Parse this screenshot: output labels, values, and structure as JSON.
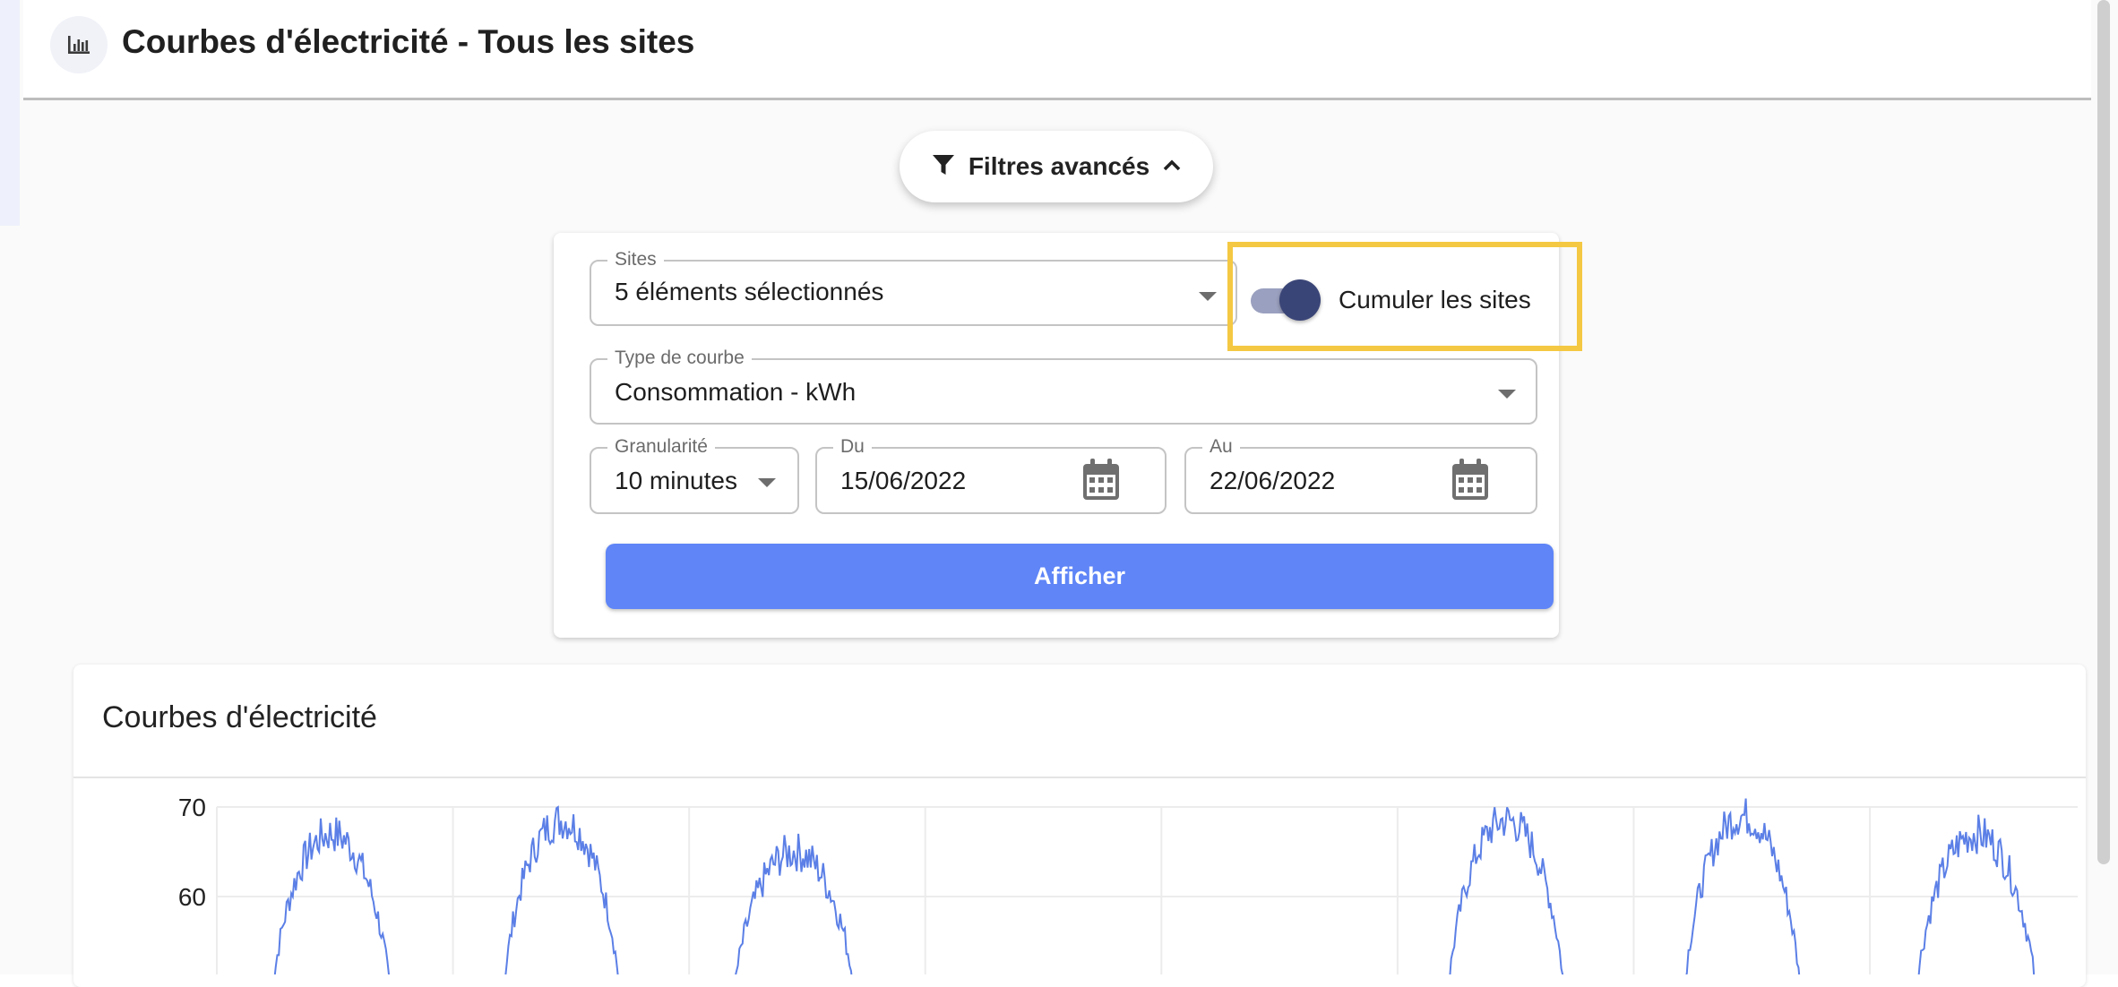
{
  "header": {
    "title": "Courbes d'électricité - Tous les sites",
    "icon": "bar-chart-icon"
  },
  "filters": {
    "toggle_label": "Filtres avancés",
    "toggle_icon": "filter-icon",
    "toggle_state_icon": "chevron-up-icon",
    "sites": {
      "label": "Sites",
      "value": "5 éléments sélectionnés"
    },
    "cumulate": {
      "label": "Cumuler les sites",
      "checked": true
    },
    "curve_type": {
      "label": "Type de courbe",
      "value": "Consommation - kWh"
    },
    "granularity": {
      "label": "Granularité",
      "value": "10 minutes"
    },
    "from": {
      "label": "Du",
      "value": "15/06/2022"
    },
    "to": {
      "label": "Au",
      "value": "22/06/2022"
    },
    "submit_label": "Afficher"
  },
  "chart": {
    "title": "Courbes d'électricité"
  },
  "chart_data": {
    "type": "line",
    "title": "Courbes d'électricité",
    "xlabel": "",
    "ylabel": "",
    "ytick_labels": [
      "70",
      "60"
    ],
    "ylim_visible": [
      51,
      70
    ],
    "grid": true,
    "color": "#5b7fe6",
    "days": [
      {
        "start": 0.22,
        "end": 0.75,
        "peak": 67
      },
      {
        "start": 1.2,
        "end": 1.72,
        "peak": 68.5
      },
      {
        "start": 2.17,
        "end": 2.72,
        "peak": 65
      },
      {
        "start": 5.2,
        "end": 5.72,
        "peak": 68.5
      },
      {
        "start": 6.2,
        "end": 6.72,
        "peak": 69
      },
      {
        "start": 7.18,
        "end": 7.72,
        "peak": 67
      }
    ],
    "baseline": 40,
    "x_range": [
      0,
      7.88
    ]
  },
  "colors": {
    "accent": "#5f85f7",
    "switch_thumb": "#3a4577",
    "highlight_border": "#f4c842",
    "series": "#5b7fe6"
  }
}
